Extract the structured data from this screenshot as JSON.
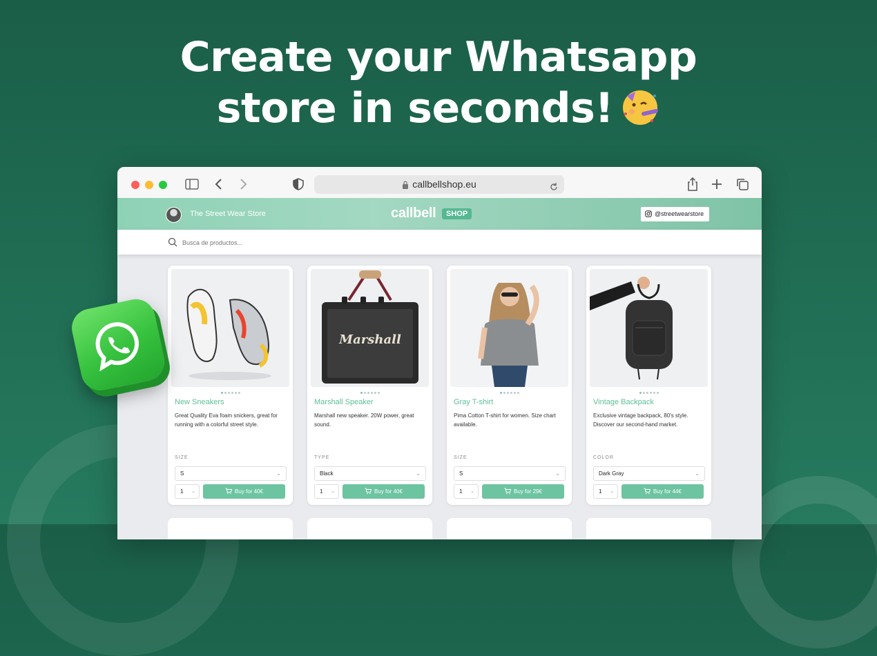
{
  "headline": {
    "line1": "Create your Whatsapp",
    "line2": "store in seconds!",
    "emoji_icon": "partying-face-icon"
  },
  "browser": {
    "url": "callbellshop.eu",
    "icons": [
      "sidebar-icon",
      "back-icon",
      "forward-icon",
      "shield-icon",
      "lock-icon",
      "reload-icon",
      "share-icon",
      "new-tab-icon",
      "tabs-icon"
    ]
  },
  "shop": {
    "store_name": "The Street Wear Store",
    "logo": "callbell",
    "logo_badge": "SHOP",
    "instagram_handle": "@streetwearstore",
    "search_placeholder": "Busca de productos..."
  },
  "products": [
    {
      "title": "New Sneakers",
      "description": "Great Quality Eva foam snickers, great for running with a colorful street style.",
      "option_label": "SIZE",
      "option_value": "S",
      "quantity": "1",
      "buy_label": "Buy for 40€"
    },
    {
      "title": "Marshall Speaker",
      "description": "Marshall new speaker. 20W power, great sound.",
      "option_label": "TYPE",
      "option_value": "Black",
      "quantity": "1",
      "buy_label": "Buy for 40€",
      "image_text": "Marshall"
    },
    {
      "title": "Gray T-shirt",
      "description": "Pima Cotton T-shirt for women. Size chart available.",
      "option_label": "SIZE",
      "option_value": "S",
      "quantity": "1",
      "buy_label": "Buy for 29€"
    },
    {
      "title": "Vintage Backpack",
      "description": "Exclusive vintage backpack, 80's style. Discover our second-hand market.",
      "option_label": "COLOR",
      "option_value": "Dark Gray",
      "quantity": "1",
      "buy_label": "Buy for 44€"
    }
  ],
  "colors": {
    "background": "#1f6b52",
    "accent": "#6cc4a1",
    "title": "#5cbf98"
  }
}
